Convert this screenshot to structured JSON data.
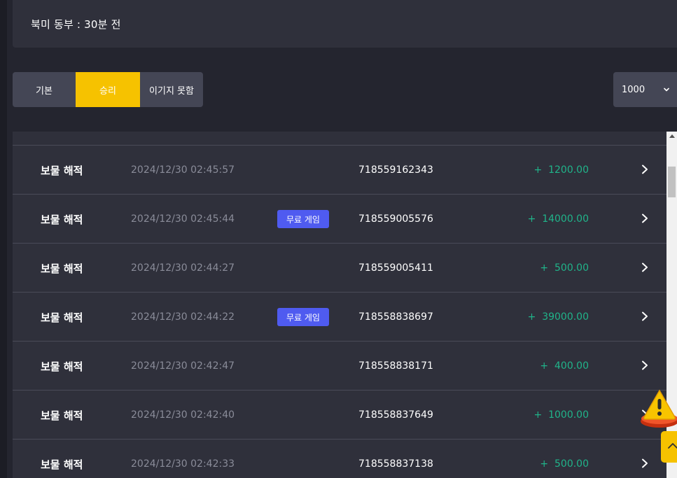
{
  "header": {
    "text": "북미 동부  : 30분 전"
  },
  "filters": [
    {
      "label": "기본",
      "active": false
    },
    {
      "label": "승리",
      "active": true
    },
    {
      "label": "이기지 못함",
      "active": false
    }
  ],
  "page_size": {
    "value": "1000"
  },
  "rows": [
    {
      "name": "보물 해적",
      "time": "2024/12/30 02:45:57",
      "badge": "",
      "id": "718559162343",
      "amount": "+  1200.00"
    },
    {
      "name": "보물 해적",
      "time": "2024/12/30 02:45:44",
      "badge": "무료 게임",
      "id": "718559005576",
      "amount": "+  14000.00"
    },
    {
      "name": "보물 해적",
      "time": "2024/12/30 02:44:27",
      "badge": "",
      "id": "718559005411",
      "amount": "+  500.00"
    },
    {
      "name": "보물 해적",
      "time": "2024/12/30 02:44:22",
      "badge": "무료 게임",
      "id": "718558838697",
      "amount": "+  39000.00"
    },
    {
      "name": "보물 해적",
      "time": "2024/12/30 02:42:47",
      "badge": "",
      "id": "718558838171",
      "amount": "+  400.00"
    },
    {
      "name": "보물 해적",
      "time": "2024/12/30 02:42:40",
      "badge": "",
      "id": "718558837649",
      "amount": "+  1000.00"
    },
    {
      "name": "보물 해적",
      "time": "2024/12/30 02:42:33",
      "badge": "",
      "id": "718558837138",
      "amount": "+  500.00"
    }
  ],
  "colors": {
    "accent": "#f6c200",
    "badge": "#4f5bf0",
    "positive": "#20b48a"
  },
  "icons": {
    "row_arrow": "chevron-right-icon",
    "select": "chevron-down-icon",
    "warning": "warning-icon",
    "top": "arrow-up-icon"
  }
}
